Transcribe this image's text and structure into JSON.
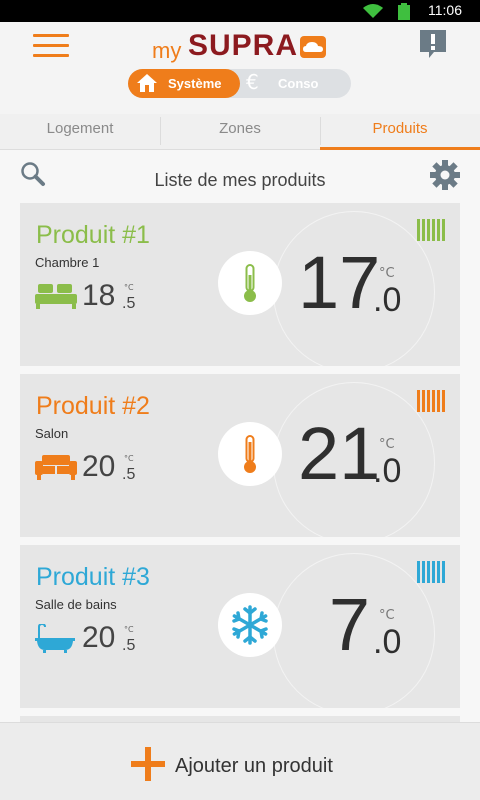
{
  "status_bar": {
    "time": "11:06",
    "icons": [
      "wifi-icon",
      "battery-icon"
    ]
  },
  "app": {
    "logo_my": "my",
    "logo_brand": "SUPRA",
    "colors": {
      "accent": "#ef7d1b",
      "brand": "#8c1a1f",
      "green": "#8bbd4a",
      "orange": "#ef7d1b",
      "blue": "#2ea8d6"
    }
  },
  "segmented": {
    "active_label": "Système",
    "inactive_label": "Conso"
  },
  "tabs": [
    {
      "label": "Logement",
      "active": false
    },
    {
      "label": "Zones",
      "active": false
    },
    {
      "label": "Produits",
      "active": true
    }
  ],
  "list": {
    "title": "Liste de mes produits"
  },
  "products": [
    {
      "name": "Produit #1",
      "room": "Chambre 1",
      "room_icon": "bed-icon",
      "measured_int": "18",
      "measured_dec": "5",
      "unit": "°C",
      "mode_icon": "thermometer-icon",
      "setpoint_int": "17",
      "setpoint_dec": "0",
      "color": "#8bbd4a"
    },
    {
      "name": "Produit #2",
      "room": "Salon",
      "room_icon": "sofa-icon",
      "measured_int": "20",
      "measured_dec": "5",
      "unit": "°C",
      "mode_icon": "thermometer-icon",
      "setpoint_int": "21",
      "setpoint_dec": "0",
      "color": "#ef7d1b"
    },
    {
      "name": "Produit #3",
      "room": "Salle de bains",
      "room_icon": "bathtub-icon",
      "measured_int": "20",
      "measured_dec": "5",
      "unit": "°C",
      "mode_icon": "snowflake-icon",
      "setpoint_int": "7",
      "setpoint_dec": "0",
      "color": "#2ea8d6"
    }
  ],
  "footer": {
    "add_label": "Ajouter un produit"
  }
}
